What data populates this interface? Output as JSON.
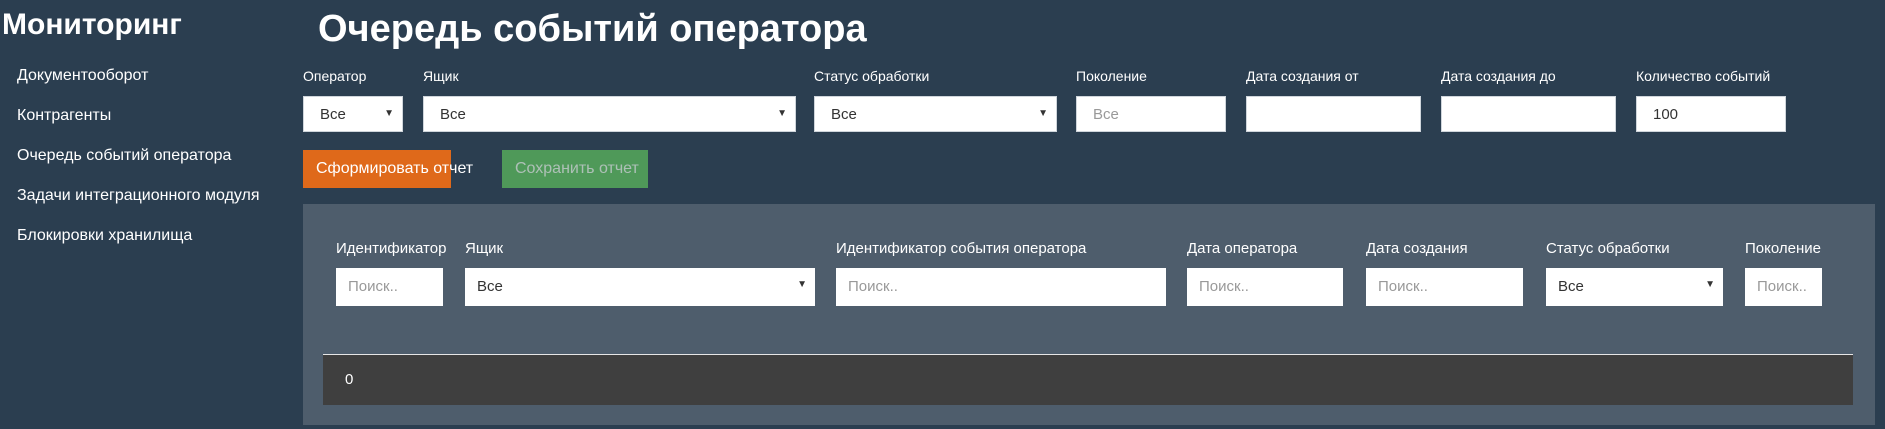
{
  "sidebar": {
    "title": "Мониторинг",
    "items": [
      {
        "label": "Документооборот"
      },
      {
        "label": "Контрагенты"
      },
      {
        "label": "Очередь событий оператора"
      },
      {
        "label": "Задачи интеграционного модуля"
      },
      {
        "label": "Блокировки хранилища"
      }
    ]
  },
  "page": {
    "title": "Очередь событий оператора"
  },
  "filters": {
    "operator": {
      "label": "Оператор",
      "value": "Все"
    },
    "box": {
      "label": "Ящик",
      "value": "Все"
    },
    "status": {
      "label": "Статус обработки",
      "value": "Все"
    },
    "generation": {
      "label": "Поколение",
      "placeholder": "Все"
    },
    "date_from": {
      "label": "Дата создания от",
      "value": ""
    },
    "date_to": {
      "label": "Дата создания до",
      "value": ""
    },
    "count": {
      "label": "Количество событий",
      "value": "100"
    }
  },
  "actions": {
    "generate": "Сформировать отчет",
    "save": "Сохранить отчет"
  },
  "table": {
    "columns": [
      {
        "label": "Идентификатор",
        "placeholder": "Поиск.."
      },
      {
        "label": "Ящик",
        "value": "Все"
      },
      {
        "label": "Идентификатор события оператора",
        "placeholder": "Поиск.."
      },
      {
        "label": "Дата оператора",
        "placeholder": "Поиск.."
      },
      {
        "label": "Дата создания",
        "placeholder": "Поиск.."
      },
      {
        "label": "Статус обработки",
        "value": "Все"
      },
      {
        "label": "Поколение",
        "placeholder": "Поиск.."
      }
    ],
    "result_count": "0"
  },
  "colors": {
    "background": "#2b3e50",
    "panel": "#4e5d6c",
    "primary_button": "#df691a",
    "success_button": "#5cb85c"
  }
}
